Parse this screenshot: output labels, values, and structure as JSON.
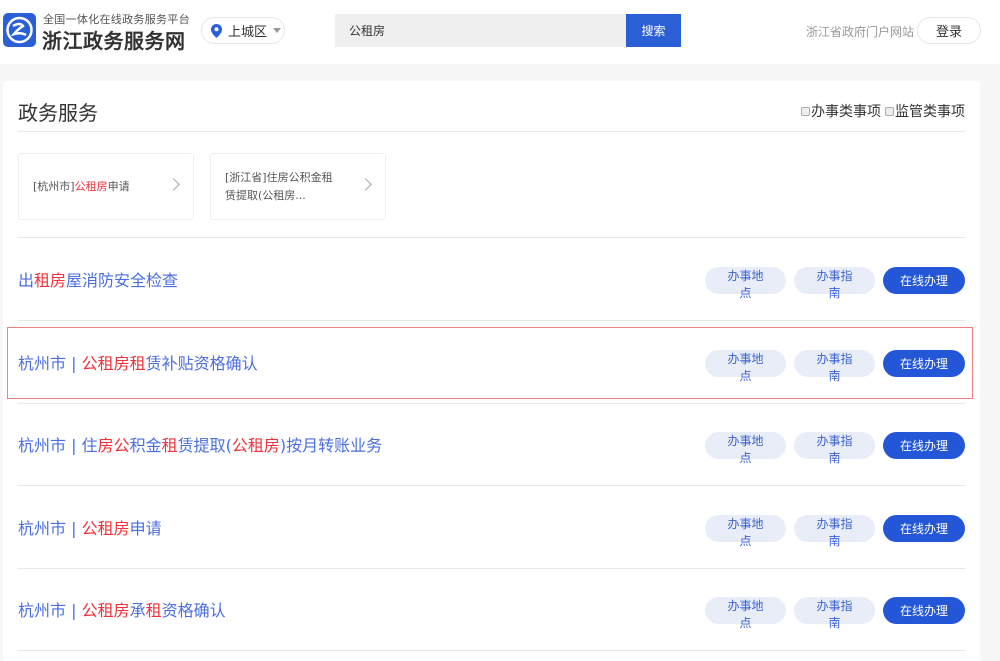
{
  "header": {
    "logo_sub": "全国一体化在线政务服务平台",
    "logo_title": "浙江政务服务网",
    "region": "上城区",
    "search_value": "公租房",
    "search_button": "搜索",
    "portal_link": "浙江省政府门户网站",
    "login": "登录"
  },
  "section": {
    "title": "政务服务",
    "filters": [
      "办事类事项",
      "监管类事项"
    ]
  },
  "quick_links": [
    {
      "parts": [
        {
          "t": "[杭州市]",
          "r": false
        },
        {
          "t": "公租房",
          "r": true
        },
        {
          "t": "申请",
          "r": false
        }
      ]
    },
    {
      "parts": [
        {
          "t": "[浙江省]住房公积金租赁提取(公租房...",
          "r": false
        }
      ]
    }
  ],
  "buttons": {
    "location": "办事地点",
    "guide": "办事指南",
    "online": "在线办理"
  },
  "rows": [
    {
      "parts": [
        {
          "t": "出",
          "r": false
        },
        {
          "t": "租房",
          "r": true
        },
        {
          "t": "屋消防安全检查",
          "r": false
        }
      ]
    },
    {
      "parts": [
        {
          "t": "杭州市 | ",
          "r": false
        },
        {
          "t": "公租房租",
          "r": true
        },
        {
          "t": "赁补贴资格确认",
          "r": false
        }
      ]
    },
    {
      "parts": [
        {
          "t": "杭州市 | 住",
          "r": false
        },
        {
          "t": "房公",
          "r": true
        },
        {
          "t": "积金",
          "r": false
        },
        {
          "t": "租",
          "r": true
        },
        {
          "t": "赁提取(",
          "r": false
        },
        {
          "t": "公租房",
          "r": true
        },
        {
          "t": ")按月转账业务",
          "r": false
        }
      ]
    },
    {
      "parts": [
        {
          "t": "杭州市 | ",
          "r": false
        },
        {
          "t": "公租房",
          "r": true
        },
        {
          "t": "申请",
          "r": false
        }
      ]
    },
    {
      "parts": [
        {
          "t": "杭州市 | ",
          "r": false
        },
        {
          "t": "公租房",
          "r": true
        },
        {
          "t": "承",
          "r": false
        },
        {
          "t": "租",
          "r": true
        },
        {
          "t": "资格确认",
          "r": false
        }
      ]
    }
  ],
  "colors": {
    "brand": "#2a5fd6",
    "highlight": "#f0313b",
    "link": "#4a6ee0"
  }
}
